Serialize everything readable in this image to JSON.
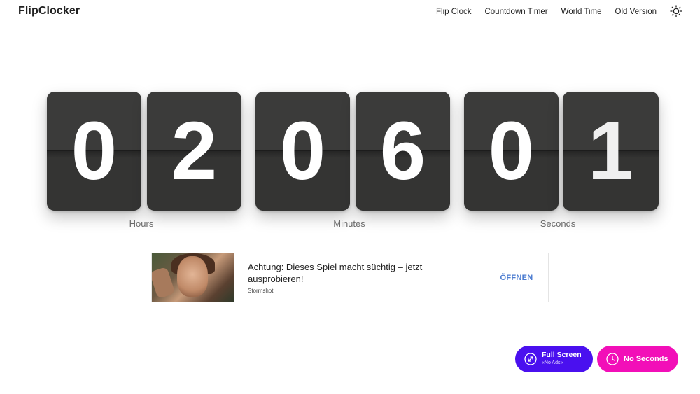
{
  "header": {
    "logo": "FlipClocker",
    "nav": [
      "Flip Clock",
      "Countdown Timer",
      "World Time",
      "Old Version"
    ],
    "theme_icon": "sun-icon"
  },
  "clock": {
    "digits": [
      "0",
      "2",
      "0",
      "6",
      "0",
      "1"
    ],
    "labels": {
      "hours": "Hours",
      "minutes": "Minutes",
      "seconds": "Seconds"
    },
    "card_color": "#3a3a39",
    "digit_color": "#ffffff"
  },
  "ad": {
    "title": "Achtung: Dieses Spiel macht süchtig – jetzt ausprobieren!",
    "brand": "Stormshot",
    "cta": "ÖFFNEN",
    "cta_color": "#4a7bd0"
  },
  "buttons": {
    "fullscreen": {
      "label": "Full Screen",
      "sublabel": "«No Ads»",
      "icon": "expand-icon",
      "color": "#4a10ef"
    },
    "no_seconds": {
      "label": "No Seconds",
      "icon": "clock-icon",
      "color": "#f20fb8"
    }
  }
}
